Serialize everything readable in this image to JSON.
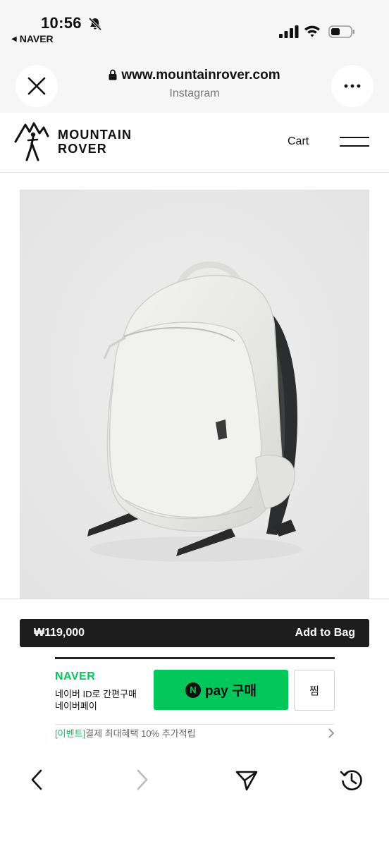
{
  "status_bar": {
    "time": "10:56",
    "back_app": "NAVER",
    "icons": [
      "bell-slash-icon",
      "signal-icon",
      "wifi-icon",
      "battery-icon"
    ]
  },
  "browser": {
    "url": "www.mountainrover.com",
    "subtitle": "Instagram",
    "close_icon": "close-icon",
    "more_icon": "more-icon"
  },
  "site": {
    "logo_line1": "MOUNTAIN",
    "logo_line2": "ROVER",
    "cart_label": "Cart"
  },
  "product": {
    "image": "white-backpack-photo",
    "price": "₩119,000",
    "add_to_bag": "Add to Bag"
  },
  "naver_pay": {
    "brand": "NAVER",
    "line1": "네이버 ID로 간편구매",
    "line2": "네이버페이",
    "pay_n": "N",
    "pay_label": "pay 구매",
    "zzim_label": "찜",
    "event_tag": "[이벤트]",
    "event_text": "결제 최대혜택 10% 추가적립"
  },
  "bottom_nav": [
    "back-icon",
    "forward-icon",
    "share-icon",
    "history-icon"
  ],
  "colors": {
    "naver_green": "#03c75a",
    "buy_bar": "#1d1d1d",
    "chrome_bg": "#f6f6f6",
    "image_bg": "#e9e9e9"
  }
}
